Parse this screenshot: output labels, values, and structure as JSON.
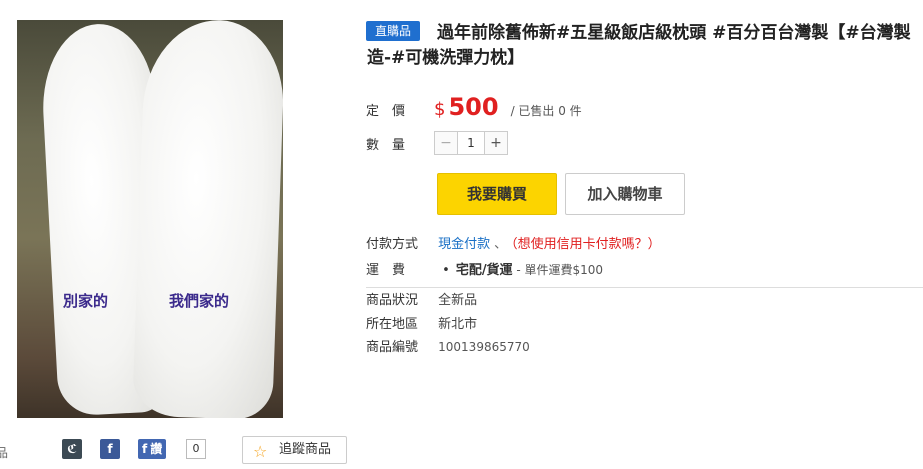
{
  "image": {
    "caption_left": "別家的",
    "caption_right": "我們家的"
  },
  "share": {
    "cut_label": "品",
    "plurk_glyph": "ℭ",
    "facebook_glyph": "f",
    "like_glyph": "f",
    "like_label": "讚",
    "like_count": "0",
    "track_label": "追蹤商品",
    "track_icon": "star-icon"
  },
  "product": {
    "badge": "直購品",
    "title": "過年前除舊佈新#五星級飯店級枕頭 #百分百台灣製【#台灣製造-#可機洗彈力枕】"
  },
  "price": {
    "label": "定　價",
    "currency": "$",
    "amount": "500",
    "sold": "/ 已售出 0 件"
  },
  "quantity": {
    "label": "數　量",
    "minus": "−",
    "value": "1",
    "plus": "+"
  },
  "actions": {
    "buy": "我要購買",
    "cart": "加入購物車"
  },
  "payment": {
    "label": "付款方式",
    "method": "現金付款",
    "separator": "、",
    "cc_link": "（想使用信用卡付款嗎？）"
  },
  "shipping": {
    "label": "運　費",
    "bullet": "•",
    "method": "宅配/貨運",
    "fee": " - 單件運費$100"
  },
  "details": {
    "condition_label": "商品狀況",
    "condition_value": "全新品",
    "location_label": "所在地區",
    "location_value": "新北市",
    "id_label": "商品編號",
    "id_value": "100139865770"
  },
  "colors": {
    "accent_blue": "#1f6fcf",
    "price_red": "#e02020",
    "buy_yellow": "#fcd400"
  }
}
